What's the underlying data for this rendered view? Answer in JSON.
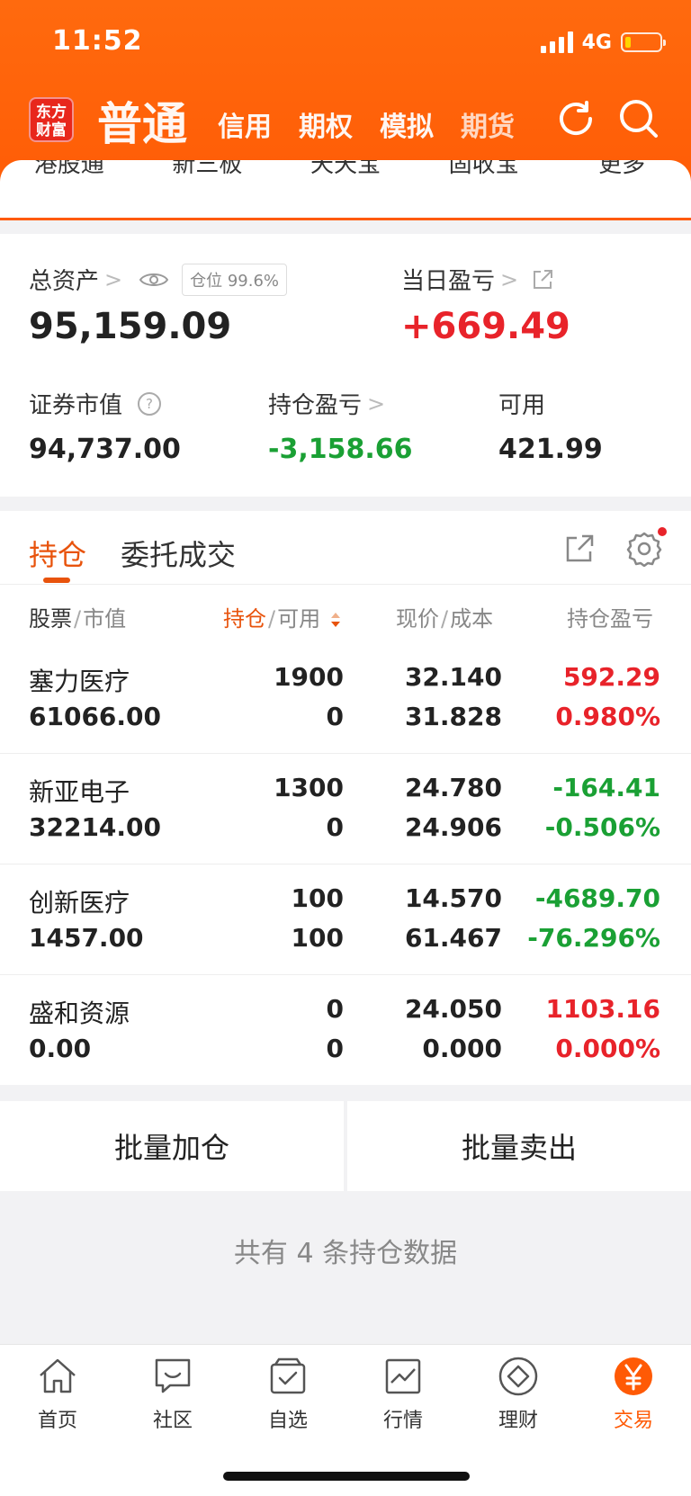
{
  "status_bar": {
    "time": "11:52",
    "network": "4G"
  },
  "header": {
    "logo_text_line1": "东方",
    "logo_text_line2": "财富",
    "tabs": [
      {
        "label": "普通",
        "active": true
      },
      {
        "label": "信用"
      },
      {
        "label": "期权"
      },
      {
        "label": "模拟"
      },
      {
        "label": "期货"
      }
    ],
    "icons": [
      "refresh-icon",
      "search-icon"
    ]
  },
  "submenu": [
    "港股通",
    "新三板",
    "天天宝",
    "固收宝",
    "更多"
  ],
  "assets": {
    "total_label": "总资产",
    "position_badge": "仓位 99.6%",
    "total_value": "95,159.09",
    "daily_pl_label": "当日盈亏",
    "daily_pl_value": "+669.49",
    "market_value_label": "证券市值",
    "market_value": "94,737.00",
    "holding_pl_label": "持仓盈亏",
    "holding_pl_value": "-3,158.66",
    "available_label": "可用",
    "available_value": "421.99"
  },
  "holdings": {
    "tabs": [
      "持仓",
      "委托成交"
    ],
    "columns": {
      "c1a": "股票",
      "c1b": "市值",
      "c2a": "持仓",
      "c2b": "可用",
      "c3a": "现价",
      "c3b": "成本",
      "c4": "持仓盈亏"
    },
    "rows": [
      {
        "name": "塞力医疗",
        "market_value": "61066.00",
        "qty": "1900",
        "available": "0",
        "price": "32.140",
        "cost": "31.828",
        "pl": "592.29",
        "pl_pct": "0.980%",
        "dir": "up"
      },
      {
        "name": "新亚电子",
        "market_value": "32214.00",
        "qty": "1300",
        "available": "0",
        "price": "24.780",
        "cost": "24.906",
        "pl": "-164.41",
        "pl_pct": "-0.506%",
        "dir": "down"
      },
      {
        "name": "创新医疗",
        "market_value": "1457.00",
        "qty": "100",
        "available": "100",
        "price": "14.570",
        "cost": "61.467",
        "pl": "-4689.70",
        "pl_pct": "-76.296%",
        "dir": "down"
      },
      {
        "name": "盛和资源",
        "market_value": "0.00",
        "qty": "0",
        "available": "0",
        "price": "24.050",
        "cost": "0.000",
        "pl": "1103.16",
        "pl_pct": "0.000%",
        "dir": "up"
      }
    ]
  },
  "batch": {
    "add_label": "批量加仓",
    "sell_label": "批量卖出"
  },
  "footer_note": "共有 4 条持仓数据",
  "bottom_nav": [
    {
      "label": "首页",
      "icon": "home-icon"
    },
    {
      "label": "社区",
      "icon": "community-icon"
    },
    {
      "label": "自选",
      "icon": "watchlist-icon"
    },
    {
      "label": "行情",
      "icon": "market-icon"
    },
    {
      "label": "理财",
      "icon": "wealth-icon"
    },
    {
      "label": "交易",
      "icon": "trade-icon",
      "active": true
    }
  ],
  "colors": {
    "brand": "#ff5a05",
    "up": "#e8232a",
    "down": "#1aa034",
    "accent": "#e8530c"
  }
}
